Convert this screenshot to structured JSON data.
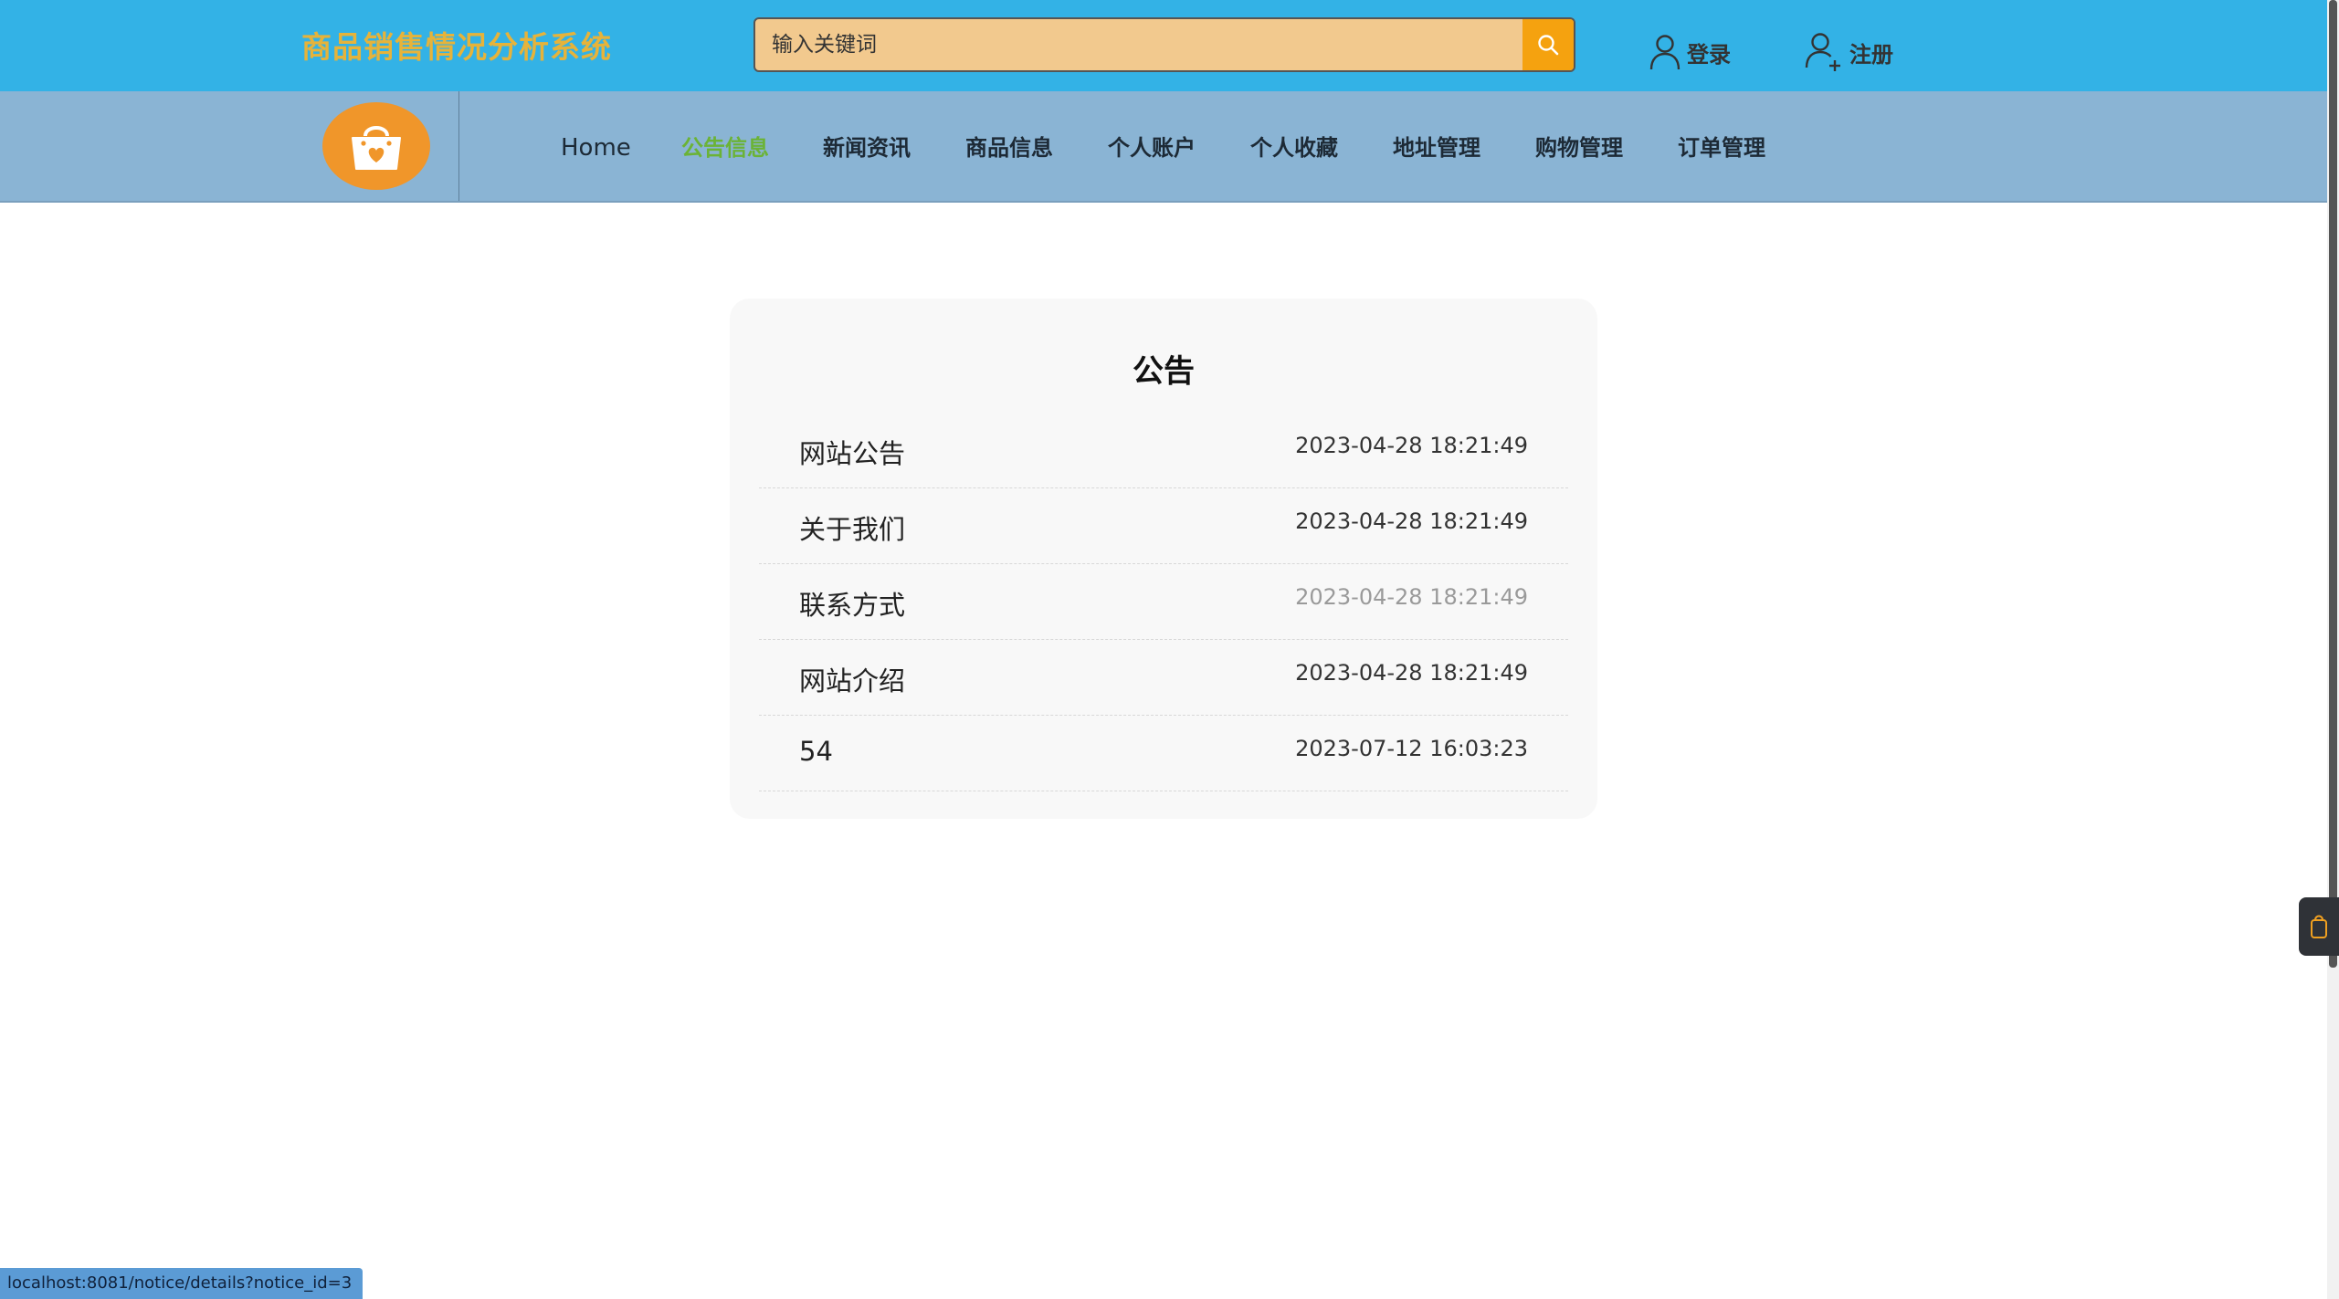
{
  "header": {
    "site_title": "商品销售情况分析系统",
    "search_placeholder": "输入关键词",
    "login_label": "登录",
    "register_label": "注册"
  },
  "nav": {
    "items": [
      {
        "label": "Home"
      },
      {
        "label": "公告信息"
      },
      {
        "label": "新闻资讯"
      },
      {
        "label": "商品信息"
      },
      {
        "label": "个人账户"
      },
      {
        "label": "个人收藏"
      },
      {
        "label": "地址管理"
      },
      {
        "label": "购物管理"
      },
      {
        "label": "订单管理"
      }
    ],
    "active_index": 1
  },
  "notices": {
    "title": "公告",
    "rows": [
      {
        "title": "网站公告",
        "time": "2023-04-28 18:21:49"
      },
      {
        "title": "关于我们",
        "time": "2023-04-28 18:21:49"
      },
      {
        "title": "联系方式",
        "time": "2023-04-28 18:21:49"
      },
      {
        "title": "网站介绍",
        "time": "2023-04-28 18:21:49"
      },
      {
        "title": "54",
        "time": "2023-07-12 16:03:23"
      }
    ]
  },
  "status_bar": {
    "url": "localhost:8081/notice/details?notice_id=3"
  },
  "colors": {
    "topbar": "#33b2e6",
    "navbar": "#8ab4d4",
    "title": "#e6b33a",
    "active_nav": "#6bb336",
    "search_button": "#f5a20f",
    "logo": "#f0962a"
  },
  "icons": {
    "search": "search-icon",
    "login": "user-icon",
    "register": "user-add-icon",
    "logo": "shopping-bag-heart-icon",
    "float_tab": "bag-icon"
  }
}
